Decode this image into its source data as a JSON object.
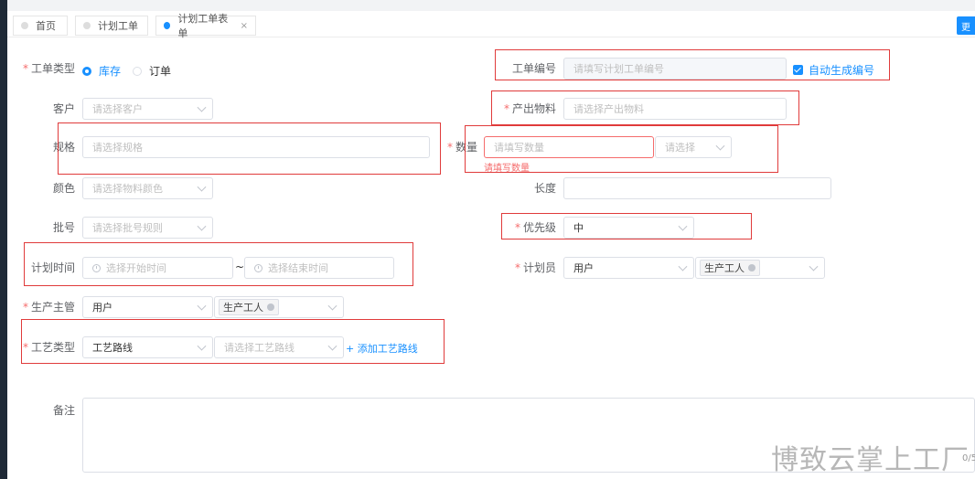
{
  "tabs": [
    {
      "label": "首页",
      "active": false
    },
    {
      "label": "计划工单",
      "active": false
    },
    {
      "label": "计划工单表单",
      "active": true,
      "close": "×"
    }
  ],
  "top_right_button": "更",
  "form": {
    "order_type": {
      "label": "工单类型",
      "options": [
        "库存",
        "订单"
      ],
      "selected": "库存"
    },
    "order_no": {
      "label": "工单编号",
      "placeholder": "请填写计划工单编号",
      "auto_label": "自动生成编号"
    },
    "customer": {
      "label": "客户",
      "placeholder": "请选择客户"
    },
    "output_material": {
      "label": "产出物料",
      "placeholder": "请选择产出物料"
    },
    "spec": {
      "label": "规格",
      "placeholder": "请选择规格"
    },
    "quantity": {
      "label": "数量",
      "placeholder": "请填写数量",
      "unit_placeholder": "请选择",
      "error": "请填写数量"
    },
    "color": {
      "label": "颜色",
      "placeholder": "请选择物料颜色"
    },
    "length": {
      "label": "长度",
      "placeholder": ""
    },
    "batch": {
      "label": "批号",
      "placeholder": "请选择批号规则"
    },
    "priority": {
      "label": "优先级",
      "value": "中"
    },
    "plan_time": {
      "label": "计划时间",
      "start_placeholder": "选择开始时间",
      "end_placeholder": "选择结束时间",
      "separator": "~"
    },
    "planner": {
      "label": "计划员",
      "type_value": "用户",
      "tag": "生产工人"
    },
    "supervisor": {
      "label": "生产主管",
      "type_value": "用户",
      "tag": "生产工人"
    },
    "process_type": {
      "label": "工艺类型",
      "value": "工艺路线",
      "route_placeholder": "请选择工艺路线",
      "add_link": "+ 添加工艺路线"
    },
    "remark": {
      "label": "备注",
      "counter": "0/5"
    }
  },
  "watermark": "博致云掌上工厂"
}
